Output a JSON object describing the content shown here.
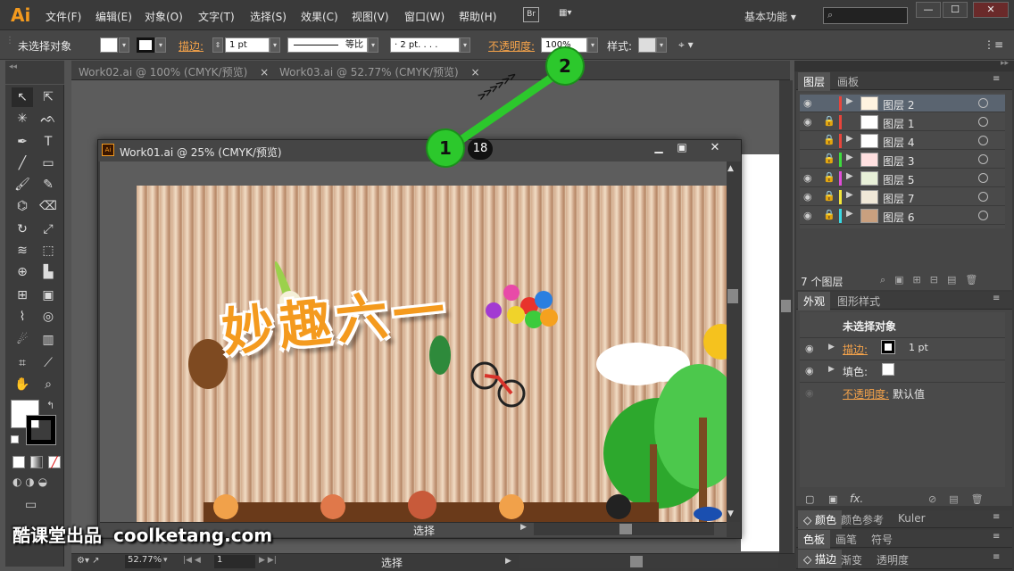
{
  "app": {
    "logo": "Ai"
  },
  "menu": [
    "文件(F)",
    "编辑(E)",
    "对象(O)",
    "文字(T)",
    "选择(S)",
    "效果(C)",
    "视图(V)",
    "窗口(W)",
    "帮助(H)"
  ],
  "bridge_label": "Br",
  "workspace_label": "基本功能",
  "window_controls": [
    "—",
    "☐",
    "✕"
  ],
  "control_bar": {
    "selection_status": "未选择对象",
    "stroke_label": "描边:",
    "stroke_weight": "1 pt",
    "stroke_profile": "等比",
    "brush_def": "· 2 pt. . . .",
    "opacity_label": "不透明度:",
    "opacity_value": "100%",
    "style_label": "样式:"
  },
  "doc_tabs": [
    {
      "label": "Work02.ai @ 100% (CMYK/预览)",
      "close": "×"
    },
    {
      "label": "Work03.ai @ 52.77% (CMYK/预览)",
      "close": "×"
    }
  ],
  "floating_window": {
    "title": "Work01.ai @ 25% (CMYK/预览)",
    "status_text": "选择"
  },
  "status_bar": {
    "zoom": "52.77%",
    "page": "1",
    "tool_text": "选择"
  },
  "artwork": {
    "title_text": "妙趣六一"
  },
  "annotations": {
    "badge_start": "1",
    "badge_end": "2",
    "step": "18",
    "arrow_chevrons": ">>>>>>"
  },
  "layers_panel": {
    "tabs": [
      "图层",
      "画板"
    ],
    "layers": [
      {
        "name": "图层 2",
        "color": "#e8453c",
        "visible": true,
        "locked": false,
        "expand": true
      },
      {
        "name": "图层 1",
        "color": "#e8453c",
        "visible": true,
        "locked": true,
        "expand": false
      },
      {
        "name": "图层 4",
        "color": "#e8453c",
        "visible": false,
        "locked": true,
        "expand": true
      },
      {
        "name": "图层 3",
        "color": "#3ddc3d",
        "visible": false,
        "locked": true,
        "expand": true
      },
      {
        "name": "图层 5",
        "color": "#e14dd8",
        "visible": true,
        "locked": true,
        "expand": true
      },
      {
        "name": "图层 7",
        "color": "#f3e63a",
        "visible": true,
        "locked": true,
        "expand": true
      },
      {
        "name": "图层 6",
        "color": "#3ad8e3",
        "visible": true,
        "locked": true,
        "expand": true
      }
    ],
    "count_text": "7 个图层"
  },
  "appearance_panel": {
    "tabs": [
      "外观",
      "图形样式"
    ],
    "header": "未选择对象",
    "stroke_label": "描边:",
    "stroke_value": "1 pt",
    "fill_label": "填色:",
    "opacity_label": "不透明度:",
    "opacity_value": "默认值",
    "fx_label": "fx."
  },
  "bottom_panels": [
    {
      "tabs": [
        "颜色",
        "颜色参考",
        "Kuler"
      ]
    },
    {
      "tabs": [
        "色板",
        "画笔",
        "符号"
      ]
    },
    {
      "tabs": [
        "描边",
        "渐变",
        "透明度"
      ]
    }
  ],
  "watermark": {
    "cn": "酷课堂出品",
    "url": "coolketang.com"
  },
  "colors": {
    "accent_orange": "#f39a1e",
    "badge_green": "#2cc82c",
    "panel_bg": "#464646"
  }
}
